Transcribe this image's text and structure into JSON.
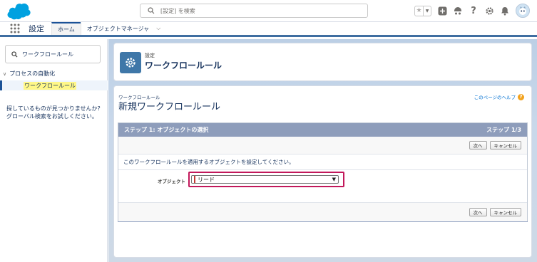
{
  "header": {
    "logo_name": "salesforce-cloud",
    "search_placeholder": "[設定] を検索",
    "icons": [
      "favorites-star-icon",
      "favorites-dropdown-icon",
      "global-actions-icon",
      "trailhead-icon",
      "help-icon",
      "setup-gear-icon",
      "notifications-bell-icon",
      "user-avatar"
    ]
  },
  "context_bar": {
    "app_name": "設定",
    "tabs": [
      {
        "label": "ホーム",
        "active": true
      },
      {
        "label": "オブジェクトマネージャ",
        "active": false
      }
    ]
  },
  "sidebar": {
    "quick_find_value": "ワークフロールール",
    "tree_parent": "プロセスの自動化",
    "tree_child": "ワークフロールール",
    "not_found_text": "探しているものが見つかりませんか? グローバル検索をお試しください。"
  },
  "page_header": {
    "eyebrow": "設定",
    "title": "ワークフロールール"
  },
  "content": {
    "breadcrumb": "ワークフロールール",
    "title": "新規ワークフロールール",
    "help_link": "このページのヘルプ",
    "step": {
      "title": "ステップ 1: オブジェクトの選択",
      "counter": "ステップ 1/3",
      "next_button": "次へ",
      "cancel_button": "キャンセル",
      "instruction": "このワークフロールールを適用するオブジェクトを設定してください。",
      "object_label": "オブジェクト",
      "object_value": "リード"
    }
  },
  "colors": {
    "brand": "#00a1e0",
    "nav_active": "#1b5297",
    "step_header": "#8e9dbb",
    "highlight": "#c2185b"
  }
}
